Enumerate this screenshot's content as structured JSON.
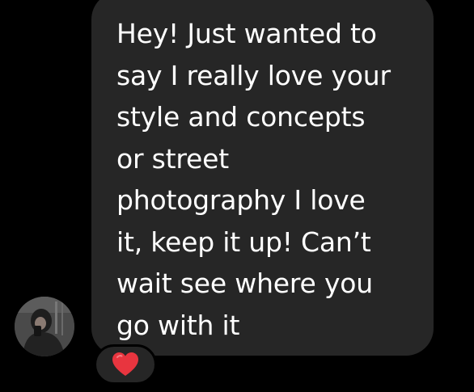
{
  "message": {
    "text": "Hey! Just wanted to\nsay I really love your\nstyle and concepts\nor street\nphotography I love\nit, keep it up! Can’t\nwait see where you\ngo with it"
  },
  "reaction": {
    "icon": "heart-icon",
    "color": "#e8353f"
  },
  "colors": {
    "background": "#000000",
    "bubble": "#262626",
    "text": "#ffffff"
  }
}
